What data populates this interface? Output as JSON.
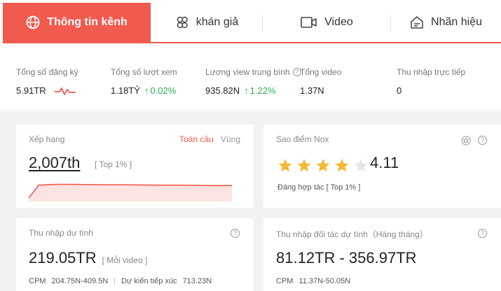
{
  "tabs": [
    {
      "label": "Thông tin kênh",
      "icon": "globe-icon",
      "active": true
    },
    {
      "label": "khán giả",
      "icon": "audience-icon",
      "active": false
    },
    {
      "label": "Video",
      "icon": "video-icon",
      "active": false
    },
    {
      "label": "Nhãn hiệu",
      "icon": "brand-icon",
      "active": false
    }
  ],
  "metrics": {
    "subscribers": {
      "label": "Tổng số đăng ký",
      "value": "5.91TR"
    },
    "views": {
      "label": "Tổng số lượt xem",
      "value": "1.18TỶ",
      "change": "0.02%"
    },
    "avg_views": {
      "label": "Lượng view trung bình",
      "value": "935.82N",
      "change": "1.22%"
    },
    "videos": {
      "label": "Tổng video",
      "value": "1.37N"
    },
    "direct_income": {
      "label": "Thu nhập trực tiếp",
      "value": "0"
    }
  },
  "ranking": {
    "title": "Xếp hạng",
    "value": "2,007th",
    "top": "[ Top 1% ]",
    "scope_global": "Toàn cầu",
    "scope_region": "Vùng",
    "trend": [
      45,
      12,
      10,
      10,
      10.5,
      11,
      11,
      11.5,
      12,
      12,
      12.5,
      13,
      13
    ]
  },
  "nox_score": {
    "title": "Sao điểm Nox",
    "score": "4.11",
    "rating": 4.11,
    "max_stars": 5,
    "partner": "Đáng hợp tác [ Top 1% ]"
  },
  "estimated_income": {
    "title": "Thu nhập dự tính",
    "value": "219.05TR",
    "sub": "[ Mỗi video ]",
    "cpm_label": "CPM",
    "cpm_value": "204.75N-409.5N",
    "reach_label": "Dự kiến tiếp xúc",
    "reach_value": "713.23N"
  },
  "partner_income": {
    "title": "Thu nhập đối tác dự tính（Hàng tháng）",
    "value": "81.12TR - 356.97TR",
    "cpm_label": "CPM",
    "cpm_value": "11.37N-50.05N"
  },
  "colors": {
    "accent": "#f15a4e",
    "up": "#2aa952",
    "star": "#f5b82e",
    "star_empty": "#e6e6e6"
  }
}
